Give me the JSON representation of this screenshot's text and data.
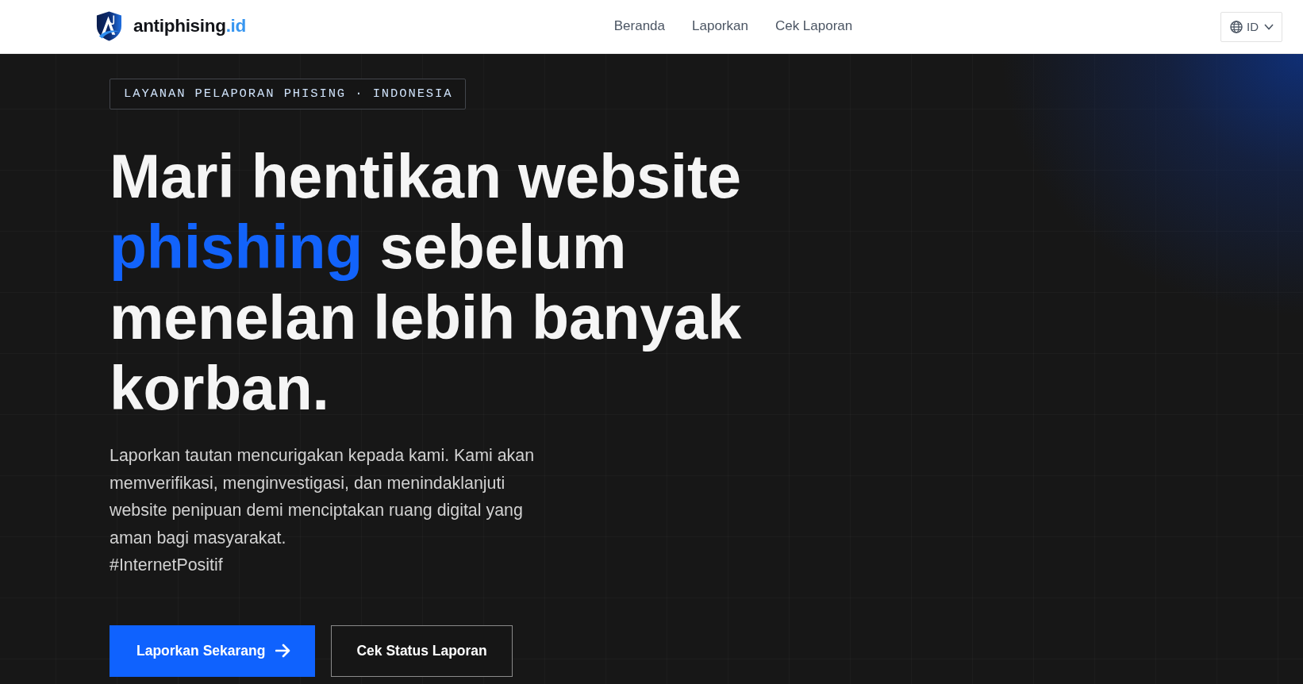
{
  "header": {
    "logo": {
      "name": "antiphising",
      "suffix": ".id"
    },
    "nav": [
      {
        "label": "Beranda"
      },
      {
        "label": "Laporkan"
      },
      {
        "label": "Cek Laporan"
      }
    ],
    "language": {
      "label": "ID"
    }
  },
  "hero": {
    "badge": "LAYANAN PELAPORAN PHISING · INDONESIA",
    "heading": [
      {
        "text": "Mari hentikan website ",
        "highlight": false
      },
      {
        "text": "phishing",
        "highlight": true
      },
      {
        "text": " sebelum menelan lebih banyak korban.",
        "highlight": false
      }
    ],
    "description": "Laporkan tautan mencurigakan kepada kami. Kami akan memverifikasi, menginvestigasi, dan menindaklanjuti website penipuan demi menciptakan ruang digital yang aman bagi masyarakat.",
    "hashtag": "#InternetPositif",
    "buttons": [
      {
        "label": "Laporkan Sekarang",
        "kind": "primary"
      },
      {
        "label": "Cek Status Laporan",
        "kind": "secondary"
      }
    ]
  }
}
